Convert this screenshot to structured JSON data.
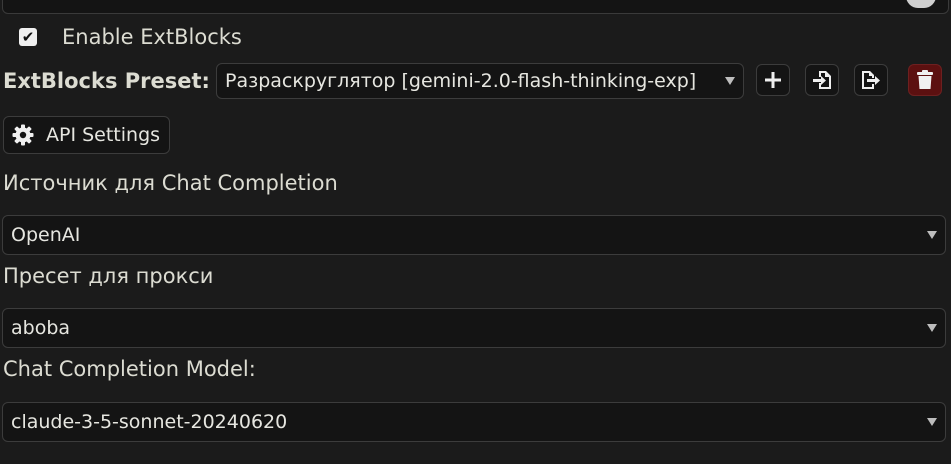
{
  "extblocks": {
    "enable_label": "Enable ExtBlocks",
    "enabled": true,
    "preset_label": "ExtBlocks Preset:",
    "preset_value": "Разраскруглятор [gemini-2.0-flash-thinking-exp]"
  },
  "toolbar_icons": [
    "plus-icon",
    "import-icon",
    "export-icon",
    "trash-icon"
  ],
  "api_settings": {
    "label": "API Settings",
    "icon": "gear-icon"
  },
  "chat_source": {
    "label": "Источник для Chat Completion",
    "value": "OpenAI"
  },
  "proxy_preset": {
    "label": "Пресет для прокси",
    "value": "aboba"
  },
  "model": {
    "label": "Chat Completion Model:",
    "value": "claude-3-5-sonnet-20240620"
  },
  "colors": {
    "danger": "#5c1010",
    "background": "#1b1b1b",
    "field": "#141414"
  }
}
